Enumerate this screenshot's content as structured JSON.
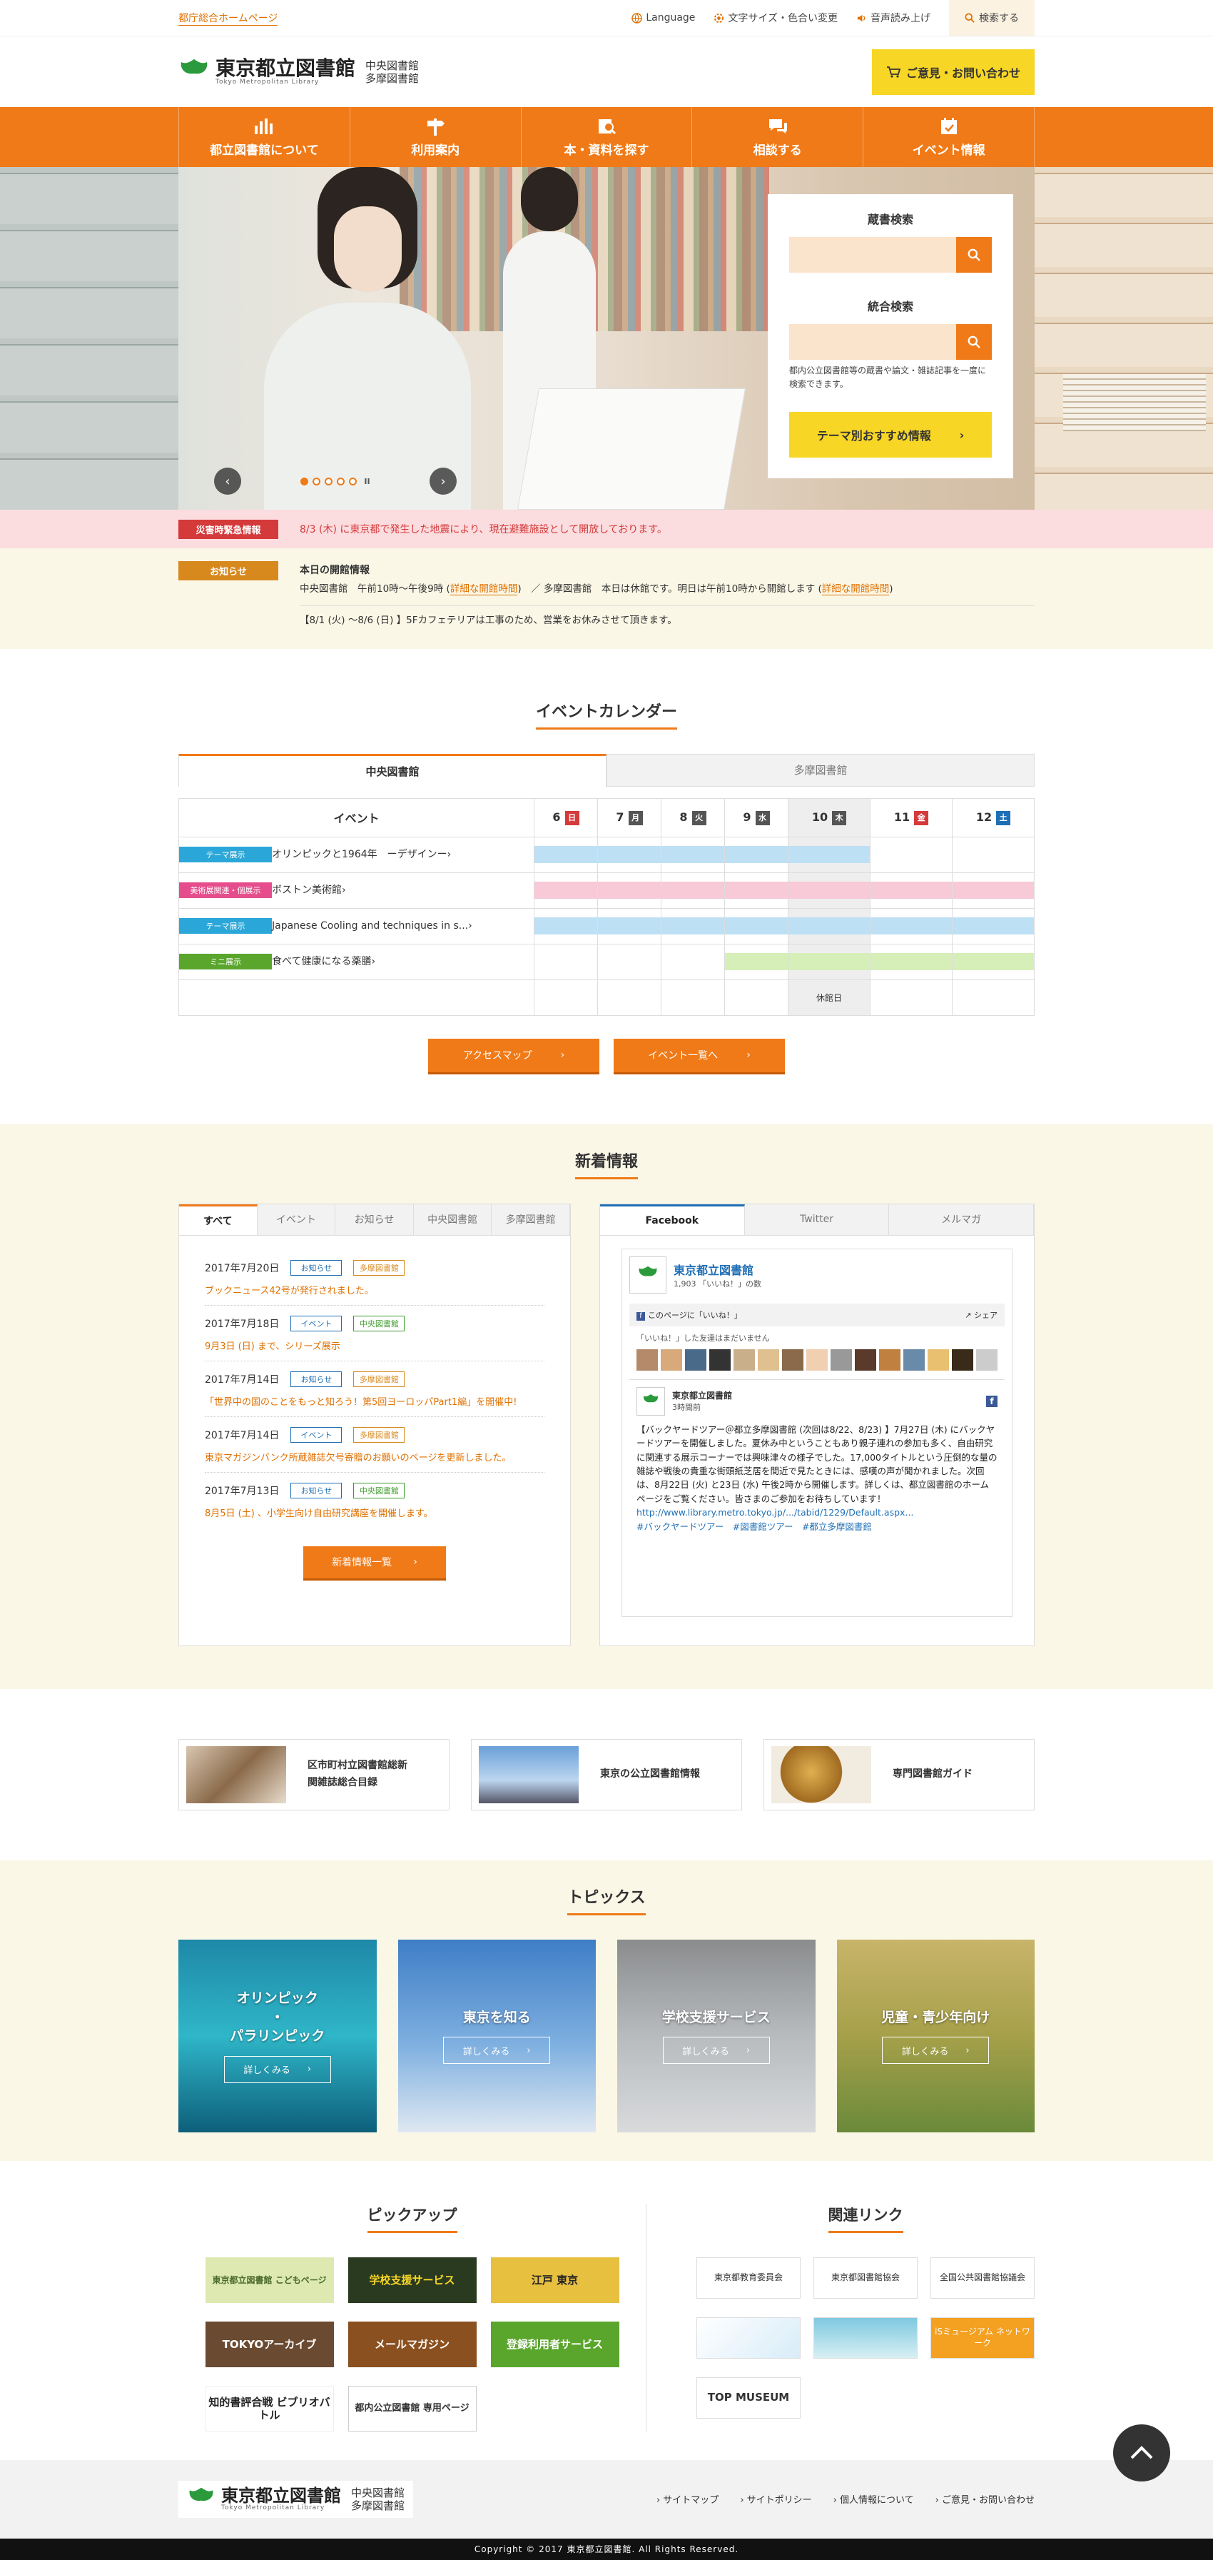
{
  "topbar": {
    "portal_link": "都庁総合ホームページ",
    "language": "Language",
    "font_color": "文字サイズ・色合い変更",
    "voice": "音声読み上げ",
    "search": "検索する"
  },
  "header": {
    "logo_title": "東京都立図書館",
    "logo_sub": "Tokyo Metropolitan Library",
    "branch1": "中央図書館",
    "branch2": "多摩図書館",
    "contact": "ご意見・お問い合わせ"
  },
  "nav": [
    {
      "label": "都立図書館について",
      "icon": "chart-icon"
    },
    {
      "label": "利用案内",
      "icon": "signpost-icon"
    },
    {
      "label": "本・資料を探す",
      "icon": "book-search-icon"
    },
    {
      "label": "相談する",
      "icon": "chat-icon"
    },
    {
      "label": "イベント情報",
      "icon": "calendar-icon"
    }
  ],
  "hero": {
    "search1_title": "蔵書検索",
    "search2_title": "統合検索",
    "search2_note": "都内公立図書館等の蔵書や論文・雑誌記事を一度に検索できます。",
    "theme_button": "テーマ別おすすめ情報",
    "pause": "II"
  },
  "alert": {
    "badge": "災害時緊急情報",
    "message": "8/3 (木) に東京都で発生した地震により、現在避難施設として開放しております。"
  },
  "notice": {
    "badge": "お知らせ",
    "heading": "本日の開館情報",
    "line1a": "中央図書館　午前10時〜午後9時 (",
    "line1link": "詳細な開館時間",
    "line1b": ")　／ 多摩図書館　本日は休館です。明日は午前10時から開館します (",
    "line1link2": "詳細な開館時間",
    "line1c": ")",
    "line2": "【8/1 (火) 〜8/6 (日) 】5Fカフェテリアは工事のため、営業をお休みさせて頂きます。"
  },
  "calendar": {
    "title": "イベントカレンダー",
    "tab_central": "中央図書館",
    "tab_tama": "多摩図書館",
    "col_event": "イベント",
    "days": [
      {
        "num": "6",
        "dow": "日",
        "type": "sun"
      },
      {
        "num": "7",
        "dow": "月",
        "type": "wk"
      },
      {
        "num": "8",
        "dow": "火",
        "type": "wk"
      },
      {
        "num": "9",
        "dow": "水",
        "type": "wk"
      },
      {
        "num": "10",
        "dow": "木",
        "type": "wk"
      },
      {
        "num": "11",
        "dow": "金",
        "type": "sun"
      },
      {
        "num": "12",
        "dow": "土",
        "type": "sat"
      }
    ],
    "events": [
      {
        "cat": "テーマ展示",
        "cat_color": "#2aa7d8",
        "name": "オリンピックと1964年　ーデザインー",
        "bar": "blue",
        "from": 0,
        "to": 4
      },
      {
        "cat": "美術展関連・個展示",
        "cat_color": "#e64d8c",
        "name": "ボストン美術館",
        "bar": "pink",
        "from": 0,
        "to": 6
      },
      {
        "cat": "テーマ展示",
        "cat_color": "#2aa7d8",
        "name": "Japanese Cooling and techniques in s...",
        "bar": "blue",
        "from": 0,
        "to": 6
      },
      {
        "cat": "ミニ展示",
        "cat_color": "#5aa62c",
        "name": "食べて健康になる薬膳",
        "bar": "green",
        "from": 3,
        "to": 6
      }
    ],
    "closed_label": "休館日",
    "access_btn": "アクセスマップ",
    "list_btn": "イベント一覧へ"
  },
  "news": {
    "title": "新着情報",
    "tabs": [
      "すべて",
      "イベント",
      "お知らせ",
      "中央図書館",
      "多摩図書館"
    ],
    "items": [
      {
        "date": "2017年7月20日",
        "tag1": "お知らせ",
        "tag2": "多摩図書館",
        "title": "ブックニュース42号が発行されました。"
      },
      {
        "date": "2017年7月18日",
        "tag1": "イベント",
        "tag2": "中央図書館",
        "title": "9月3日 (日) まで、シリーズ展示"
      },
      {
        "date": "2017年7月14日",
        "tag1": "お知らせ",
        "tag2": "多摩図書館",
        "title": "「世界中の国のことをもっと知ろう！第5回ヨーロッパPart1編」を開催中!"
      },
      {
        "date": "2017年7月14日",
        "tag1": "イベント",
        "tag2": "多摩図書館",
        "title": "東京マガジンバンク所蔵雑誌欠号寄贈のお願いのページを更新しました。"
      },
      {
        "date": "2017年7月13日",
        "tag1": "お知らせ",
        "tag2": "中央図書館",
        "title": "8月5日 (土) 、小学生向け自由研究講座を開催します。"
      }
    ],
    "more": "新着情報一覧",
    "sns_tabs": [
      "Facebook",
      "Twitter",
      "メルマガ"
    ],
    "fb_name": "東京都立図書館",
    "fb_likes": "1,903 「いいね！」の数",
    "fb_like_page": "このページに「いいね！」",
    "fb_share": "シェア",
    "fb_friends": "「いいね！」した友達はまだいません",
    "fb_post_name": "東京都立図書館",
    "fb_post_time": "3時間前",
    "fb_post_text": "【バックヤードツアー＠都立多摩図書館 (次回は8/22、8/23) 】7月27日 (木) にバックヤードツアーを開催しました。夏休み中ということもあり親子連れの参加も多く、自由研究に関連する展示コーナーでは興味津々の様子でした。17,000タイトルという圧倒的な量の雑誌や戦後の貴重な街頭紙芝居を間近で見たときには、感嘆の声が聞かれました。次回は、8月22日 (火) と23日 (水) 午後2時から開催します。詳しくは、都立図書館のホームページをご覧ください。皆さまのご参加をお待ちしています！",
    "fb_post_url": "http://www.library.metro.tokyo.jp/.../tabid/1229/Default.aspx...",
    "fb_post_tags": "#バックヤードツアー　#図書館ツアー　#都立多摩図書館"
  },
  "banners": [
    {
      "label1": "区市町村立図書館総新",
      "label2": "関雑誌総合目録"
    },
    {
      "label1": "東京の公立図書館情報",
      "label2": ""
    },
    {
      "label1": "専門図書館ガイド",
      "label2": ""
    }
  ],
  "topics": {
    "title": "トピックス",
    "detail": "詳しくみる",
    "cards": [
      {
        "t1": "オリンピック",
        "t2": "・",
        "t3": "パラリンピック"
      },
      {
        "t1": "東京を知る",
        "t2": "",
        "t3": ""
      },
      {
        "t1": "学校支援サービス",
        "t2": "",
        "t3": ""
      },
      {
        "t1": "児童・青少年向け",
        "t2": "",
        "t3": ""
      }
    ]
  },
  "pickup": {
    "title": "ピックアップ",
    "items": [
      "東京都立図書館 こどもページ",
      "学校支援サービス",
      "江戸 東京",
      "TOKYOアーカイブ",
      "メールマガジン",
      "登録利用者サービス",
      "知的書評合戦 ビブリオバトル",
      "都内公立図書館 専用ページ"
    ]
  },
  "related": {
    "title": "関連リンク",
    "items": [
      "東京都教育委員会",
      "東京都図書館協会",
      "全国公共図書館協議会",
      "",
      "",
      "iSミュージアム ネットワーク",
      "TOP MUSEUM"
    ]
  },
  "footer": {
    "links": [
      "サイトマップ",
      "サイトポリシー",
      "個人情報について",
      "ご意見・お問い合わせ"
    ],
    "copyright": "Copyright © 2017 東京都立図書館. All Rights Reserved."
  }
}
